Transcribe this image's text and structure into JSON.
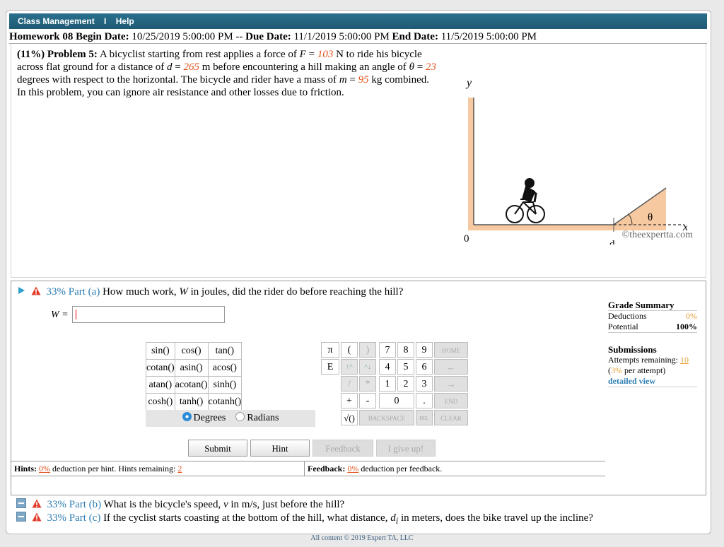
{
  "nav": {
    "class_management": "Class Management",
    "separator": "I",
    "help": "Help"
  },
  "homework": {
    "title": "Homework 08",
    "begin_label": "Begin Date:",
    "begin_value": "10/25/2019 5:00:00 PM --",
    "due_label": "Due Date:",
    "due_value": "11/1/2019 5:00:00 PM",
    "end_label": "End Date:",
    "end_value": "11/5/2019 5:00:00 PM"
  },
  "problem": {
    "weight": "(11%)",
    "label": "Problem 5:",
    "text_1": "A bicyclist starting from rest applies a force of",
    "F_sym": "F",
    "F_val": "103",
    "text_2": "N to ride his bicycle across flat ground for a distance of",
    "d_sym": "d",
    "d_val": "265",
    "text_3": "m before encountering a hill making an angle of",
    "theta_sym": "θ",
    "theta_val": "23",
    "text_4": "degrees with respect to the horizontal. The bicycle and rider have a mass of",
    "m_sym": "m",
    "m_val": "95",
    "text_5": "kg combined. In this problem, you can ignore air resistance and other losses due to friction."
  },
  "diagram": {
    "y_label": "y",
    "x_label": "x",
    "origin_label": "0",
    "d_label": "d",
    "theta_label": "θ",
    "copyright": "©theexpertta.com"
  },
  "part_a": {
    "percent": "33%",
    "part": "Part (a)",
    "question": "How much work,",
    "var": "W",
    "question_rest": "in joules, did the rider do before reaching the hill?",
    "input_label": "W =",
    "input_value": ""
  },
  "calculator": {
    "functions": [
      [
        "sin()",
        "cos()",
        "tan()"
      ],
      [
        "cotan()",
        "asin()",
        "acos()"
      ],
      [
        "atan()",
        "acotan()",
        "sinh()"
      ],
      [
        "cosh()",
        "tanh()",
        "cotanh()"
      ]
    ],
    "degrees": "Degrees",
    "radians": "Radians",
    "keys": {
      "pi": "π",
      "lparen": "(",
      "rparen": ")",
      "E": "E",
      "up": "↑^",
      "updown": "^↓",
      "slash": "/",
      "star": "*",
      "plus": "+",
      "minus": "-",
      "sqrt": "√()",
      "seven": "7",
      "eight": "8",
      "nine": "9",
      "four": "4",
      "five": "5",
      "six": "6",
      "one": "1",
      "two": "2",
      "three": "3",
      "zero": "0",
      "dot": ".",
      "home": "HOME",
      "left": "←",
      "right": "→",
      "end": "END",
      "backspace": "BACKSPACE",
      "del": "DEL",
      "clear": "CLEAR"
    }
  },
  "buttons": {
    "submit": "Submit",
    "hint": "Hint",
    "feedback": "Feedback",
    "give_up": "I give up!"
  },
  "hints": {
    "label": "Hints:",
    "deduction": "0%",
    "text": "deduction per hint. Hints remaining:",
    "remaining": "2",
    "feedback_label": "Feedback:",
    "feedback_deduction": "0%",
    "feedback_text": "deduction per feedback."
  },
  "grade": {
    "title": "Grade Summary",
    "deductions_label": "Deductions",
    "deductions": "0%",
    "potential_label": "Potential",
    "potential": "100%",
    "submissions_title": "Submissions",
    "attempts_label": "Attempts remaining:",
    "attempts": "10",
    "per_attempt_pct": "3%",
    "per_attempt_text": "per attempt)",
    "detailed_view": "detailed view"
  },
  "part_b": {
    "percent": "33%",
    "part": "Part (b)",
    "question": "What is the bicycle's speed,",
    "var": "v",
    "question_rest": "in m/s, just before the hill?"
  },
  "part_c": {
    "percent": "33%",
    "part": "Part (c)",
    "question": "If the cyclist starts coasting at the bottom of the hill, what distance,",
    "var": "d",
    "var_sub": "i",
    "question_rest": "in meters, does the bike travel up the incline?"
  },
  "footer": "All content © 2019 Expert TA, LLC",
  "colors": {
    "nav_bg": "#1f5a74",
    "highlight": "#e2521d",
    "link": "#2e7fb5",
    "ground": "#f7c9a0"
  }
}
